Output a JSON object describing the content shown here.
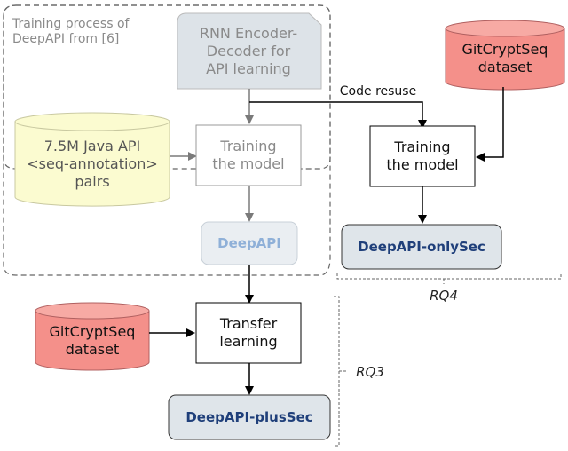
{
  "diagram": {
    "region_title": "Training process of\nDeepAPI from [6]",
    "rnn_box": "RNN Encoder-\nDecoder for\nAPI learning",
    "java_dataset": "7.5M Java API\n<seq-annotation>\npairs",
    "train_gray": "Training\nthe model",
    "deepapi": "DeepAPI",
    "code_reuse": "Code resuse",
    "gitcrypt_top": "GitCryptSeq\ndataset",
    "train_right": "Training\nthe model",
    "only_sec": "DeepAPI-onlySec",
    "rq4": "RQ4",
    "gitcrypt_bottom": "GitCryptSeq\ndataset",
    "transfer": "Transfer\nlearning",
    "plus_sec": "DeepAPI-plusSec",
    "rq3": "RQ3"
  },
  "colors": {
    "dataset_red": "#f4908a",
    "dataset_yellow": "#fbfbd0",
    "model_box": "#dfe5ea",
    "rnn_box": "#dde3e8"
  }
}
